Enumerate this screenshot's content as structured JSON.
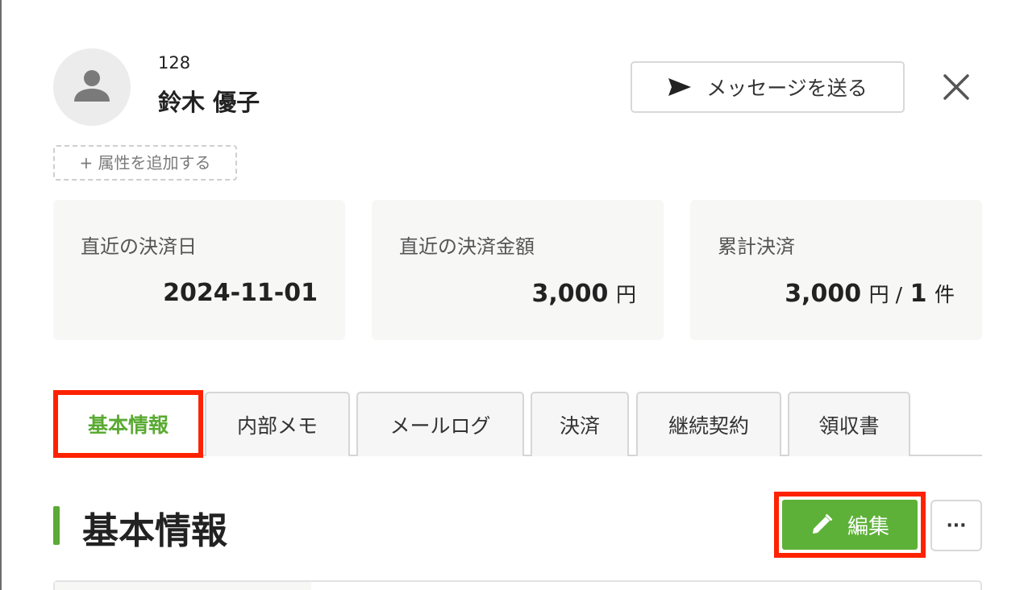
{
  "customer": {
    "id": "128",
    "name": "鈴木 優子",
    "add_attribute_label": "+ 属性を追加する"
  },
  "header": {
    "send_message_label": "メッセージを送る"
  },
  "stats": [
    {
      "label": "直近の決済日",
      "value": "2024-11-01",
      "unit": "",
      "extra": "",
      "extra_unit": ""
    },
    {
      "label": "直近の決済金額",
      "value": "3,000",
      "unit": "円",
      "extra": "",
      "extra_unit": ""
    },
    {
      "label": "累計決済",
      "value": "3,000",
      "unit": "円 /",
      "extra": "1",
      "extra_unit": "件"
    }
  ],
  "tabs": [
    {
      "label": "基本情報",
      "active": true
    },
    {
      "label": "内部メモ",
      "active": false
    },
    {
      "label": "メールログ",
      "active": false
    },
    {
      "label": "決済",
      "active": false
    },
    {
      "label": "継続契約",
      "active": false
    },
    {
      "label": "領収書",
      "active": false
    }
  ],
  "section": {
    "title": "基本情報",
    "edit_label": "編集",
    "more_label": "···"
  },
  "colors": {
    "accent": "#5aaa33",
    "highlight": "#ff2200"
  },
  "icons": [
    "person-icon",
    "send-icon",
    "close-icon",
    "pencil-icon",
    "more-icon"
  ]
}
